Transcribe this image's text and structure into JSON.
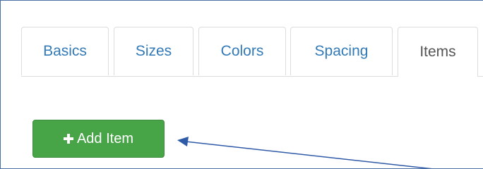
{
  "tabs": [
    {
      "label": "Basics",
      "active": false
    },
    {
      "label": "Sizes",
      "active": false
    },
    {
      "label": "Colors",
      "active": false
    },
    {
      "label": "Spacing",
      "active": false
    },
    {
      "label": "Items",
      "active": true
    }
  ],
  "add_item_button": {
    "label": "Add Item",
    "icon": "plus-icon",
    "color": "#47a447"
  },
  "colors": {
    "tab_link": "#337ab7",
    "tab_active_text": "#555555",
    "arrow": "#2e5aa8",
    "frame_border": "#4a6fa5"
  }
}
